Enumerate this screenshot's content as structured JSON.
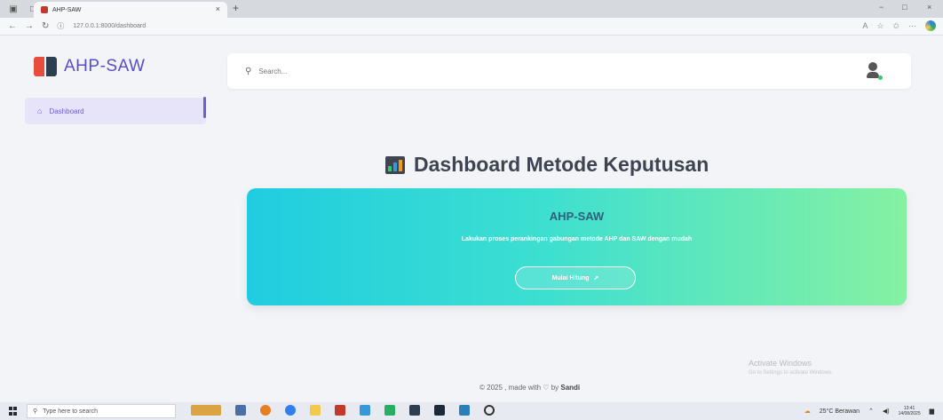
{
  "browser": {
    "tab_title": "AHP-SAW",
    "tab_close": "×",
    "new_tab": "+",
    "url": "127.0.0.1:8000/dashboard",
    "window_controls": [
      "−",
      "□",
      "×"
    ]
  },
  "sidebar": {
    "brand": "AHP-SAW",
    "items": [
      {
        "label": "Dashboard",
        "icon": "home-icon",
        "active": true
      }
    ]
  },
  "topbar": {
    "search_placeholder": "Search..."
  },
  "main": {
    "title": "Dashboard Metode Keputusan",
    "hero": {
      "title": "AHP-SAW",
      "subtitle": "Lakukan proses perankingan gabungan metode AHP dan SAW dengan mudah",
      "button_label": "Mulai Hitung",
      "colors": {
        "from": "#20cde0",
        "to": "#86f1a2"
      }
    },
    "footer": {
      "prefix": "© 2025 , made with",
      "by": "by",
      "author": "Sandi"
    }
  },
  "watermark": {
    "title": "Activate Windows",
    "subtitle": "Go to Settings to activate Windows."
  },
  "taskbar": {
    "search_placeholder": "Type here to search",
    "weather": "25°C Berawan",
    "time": "13:41",
    "date": "14/08/2025"
  },
  "accent": "#6c5dd3"
}
